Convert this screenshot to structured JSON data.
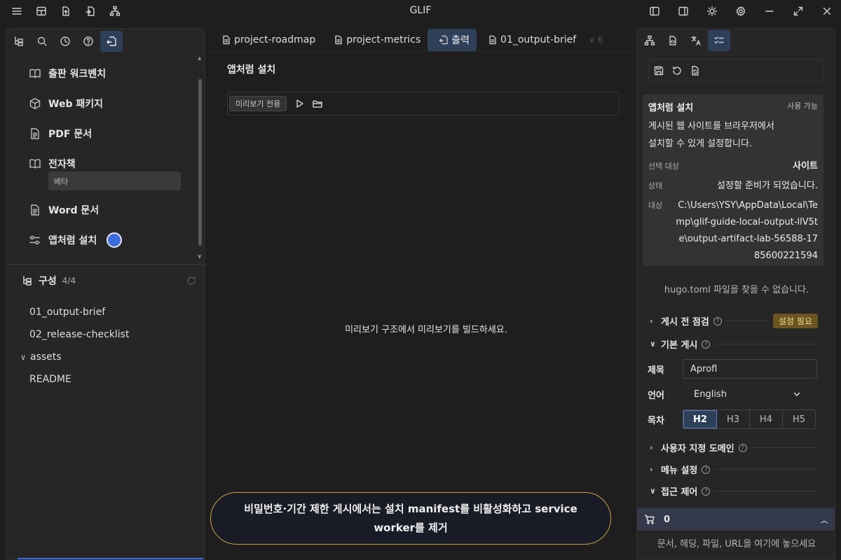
{
  "app": {
    "title": "GLIF"
  },
  "left": {
    "items": [
      {
        "label": "출판 워크벤치",
        "icon": "book-open-icon"
      },
      {
        "label": "Web 패키지",
        "icon": "package-icon"
      },
      {
        "label": "PDF 문서",
        "icon": "document-icon"
      },
      {
        "label": "전자책",
        "icon": "book-icon"
      },
      {
        "label": "Word 문서",
        "icon": "document-icon"
      },
      {
        "label": "앱처럼 설치",
        "icon": "sliders-icon"
      }
    ],
    "beta_label": "베타",
    "config": {
      "label": "구성",
      "count": "4/4",
      "tree": [
        "01_output-brief",
        "02_release-checklist",
        "assets",
        "README"
      ]
    }
  },
  "tabs": [
    {
      "label": "project-roadmap"
    },
    {
      "label": "project-metrics"
    },
    {
      "label": "출력",
      "active": true
    },
    {
      "label": "01_output-brief"
    }
  ],
  "tabs_overflow": "6",
  "center": {
    "heading": "앱처럼 설치",
    "preview_badge": "미리보기 전용",
    "message": "미리보기 구조에서 미리보기를 빌드하세요."
  },
  "toast": "비밀번호·기간 제한 게시에서는 설치 manifest를 비활성화하고 service worker를 제거",
  "right": {
    "card": {
      "title": "앱처럼 설치",
      "availability": "사용 가능",
      "description": "게시된 웹 사이트를 브라우저에서 설치할 수 있게 설정합니다.",
      "target_key": "선택 대상",
      "target_val": "사이트",
      "status_key": "상태",
      "status_val": "설정할 준비가 되었습니다.",
      "dest_key": "대상",
      "dest_val": "C:\\Users\\YSY\\AppData\\Local\\Temp\\glif-guide-local-output-llV5te\\output-artifact-lab-56588-1785600221594"
    },
    "notice": "hugo.toml 파일을 찾을 수 없습니다.",
    "sections": {
      "precheck": "게시 전 점검",
      "precheck_badge": "설정 필요",
      "basic": "기본 게시",
      "domain": "사용자 지정 도메인",
      "menu": "메뉴 설정",
      "access": "접근 제어"
    },
    "fields": {
      "title_label": "제목",
      "title_value": "Aprofl",
      "lang_label": "언어",
      "lang_value": "English",
      "toc_label": "목차",
      "toc_options": [
        "H2",
        "H3",
        "H4",
        "H5"
      ],
      "toc_selected": "H2"
    },
    "cart_count": "0",
    "drop_hint": "문서, 헤딩, 파일, URL을 여기에 놓으세요"
  },
  "colors": {
    "accent": "#3b6de0",
    "active_tab": "#2e3f5a",
    "toast_border": "#c9a23a",
    "warning_badge": "#6b5520"
  }
}
